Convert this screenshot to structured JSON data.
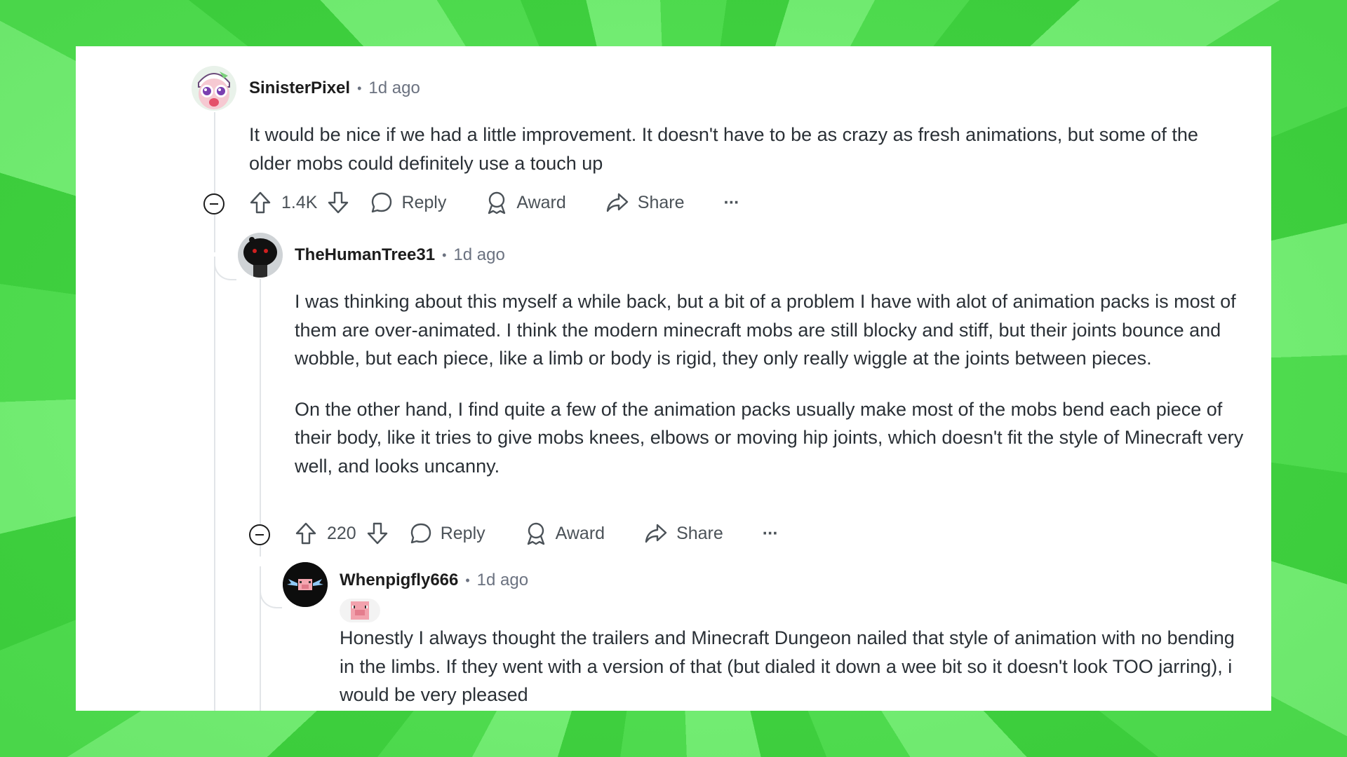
{
  "comments": [
    {
      "username": "SinisterPixel",
      "separator": "•",
      "time": "1d ago",
      "body": [
        "It would be nice if we had a little improvement. It doesn't have to be as crazy as fresh animations, but some of the older mobs could definitely use a touch up"
      ],
      "votes": "1.4K",
      "reply_label": "Reply",
      "award_label": "Award",
      "share_label": "Share",
      "more_label": "···"
    },
    {
      "username": "TheHumanTree31",
      "separator": "•",
      "time": "1d ago",
      "body": [
        "I was thinking about this myself a while back, but a bit of a problem I have with alot of animation packs is most of them are over-animated. I think the modern minecraft mobs are still blocky and stiff, but their joints bounce and wobble, but each piece, like a limb or body is rigid, they only really wiggle at the joints between pieces.",
        "On the other hand, I find quite a few of the animation packs usually make most of the mobs bend each piece of their body, like it tries to give mobs knees, elbows or moving hip joints, which doesn't fit the style of Minecraft very well, and looks uncanny."
      ],
      "votes": "220",
      "reply_label": "Reply",
      "award_label": "Award",
      "share_label": "Share",
      "more_label": "···"
    },
    {
      "username": "Whenpigfly666",
      "separator": "•",
      "time": "1d ago",
      "flair_icon": "pig-face-icon",
      "body": [
        "Honestly I always thought the trailers and Minecraft Dungeon nailed that style of animation with no bending in the limbs. If they went with a version of that (but dialed it down a wee bit so it doesn't look TOO jarring), i would be very pleased"
      ]
    }
  ],
  "colors": {
    "background_green": "#52de52",
    "card": "#ffffff",
    "text": "#2a3036",
    "meta": "#6b7280"
  }
}
